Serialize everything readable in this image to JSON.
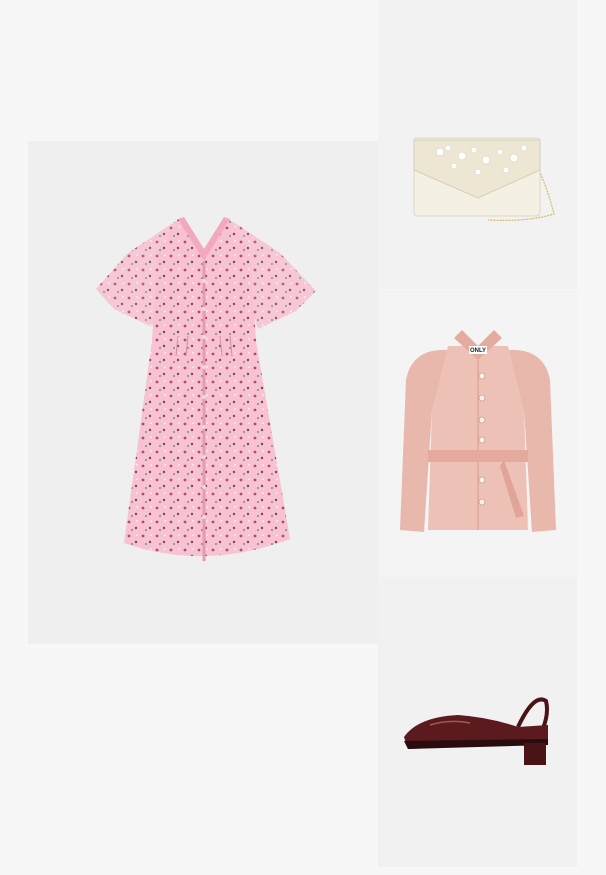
{
  "outfit": {
    "items": [
      {
        "id": "dress",
        "icon": "floral-dress-image",
        "color": "#f6bfcf"
      },
      {
        "id": "clutch",
        "icon": "beaded-clutch-image",
        "color": "#f1ede0"
      },
      {
        "id": "jacket",
        "icon": "puff-sleeve-jacket-image",
        "color": "#e9b8ad",
        "brand_tag": "ONLY"
      },
      {
        "id": "shoe",
        "icon": "slingback-shoe-image",
        "color": "#4a1416"
      }
    ]
  }
}
